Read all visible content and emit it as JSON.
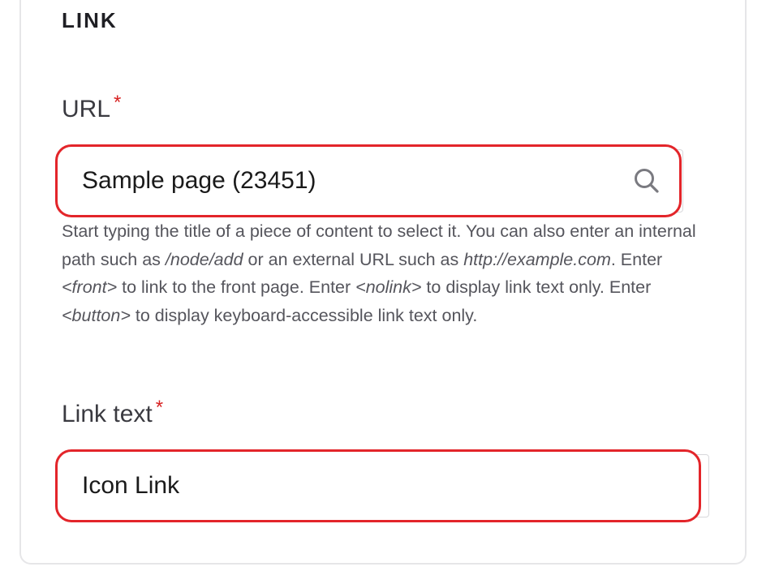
{
  "section": {
    "title": "LINK"
  },
  "url_field": {
    "label": "URL",
    "required_mark": "*",
    "value": "Sample page (23451)",
    "help": {
      "p1": "Start typing the title of a piece of content to select it. You can also enter an internal path such as ",
      "path_example": "/node/add",
      "p2": " or an external URL such as ",
      "url_example": "http://example.com",
      "p3": ". Enter ",
      "front_token": "<front>",
      "p4": " to link to the front page. Enter ",
      "nolink_token": "<nolink>",
      "p5": " to display link text only. Enter ",
      "button_token": "<button>",
      "p6": " to display keyboard-accessible link text only."
    }
  },
  "link_text_field": {
    "label": "Link text",
    "required_mark": "*",
    "value": "Icon Link"
  },
  "colors": {
    "highlight": "#e3252a",
    "required": "#d72222",
    "help_text": "#55555c"
  },
  "icons": {
    "url_field_icon": "search-icon"
  }
}
